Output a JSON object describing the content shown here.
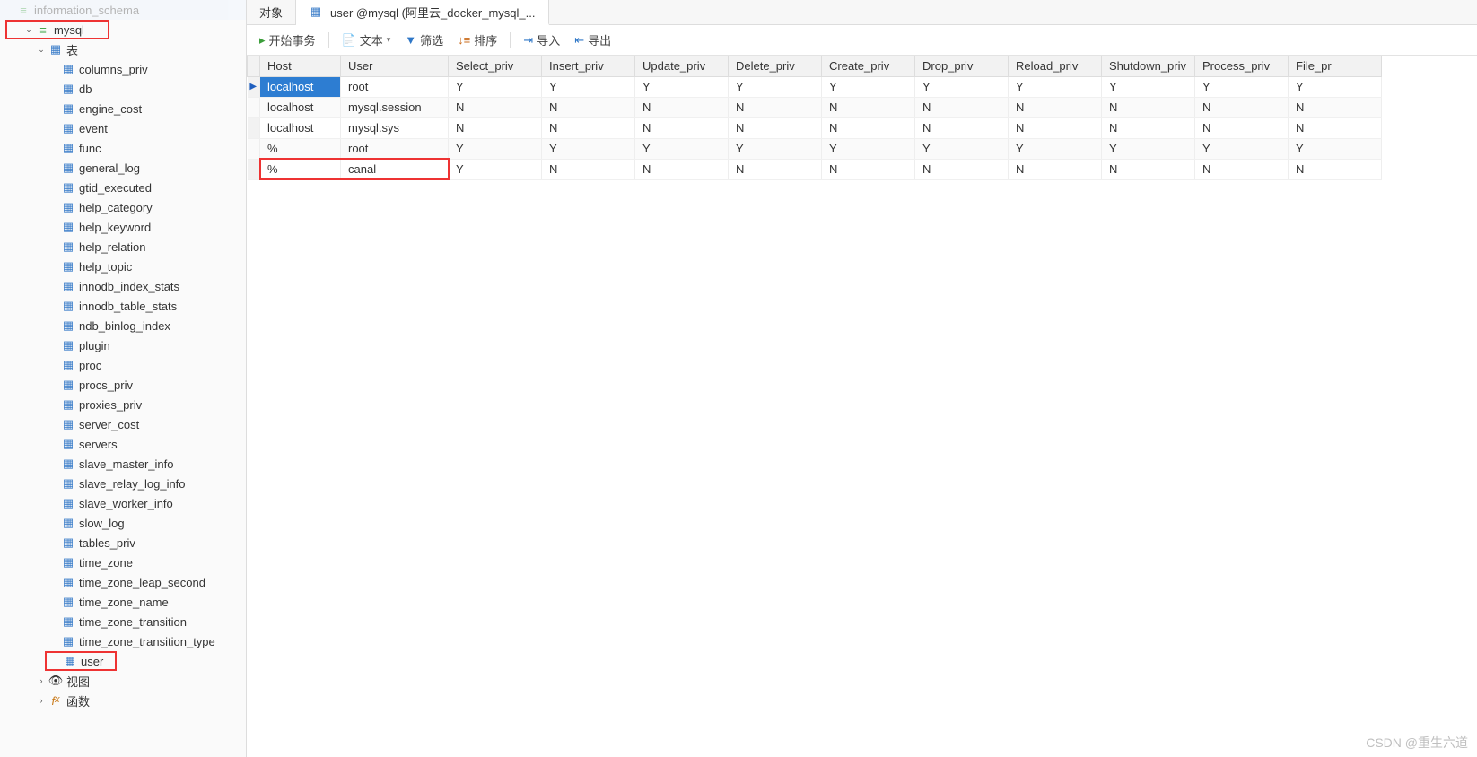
{
  "sidebar": {
    "top_cut": "information_schema",
    "db_mysql": "mysql",
    "tables_group": "表",
    "tables": [
      "columns_priv",
      "db",
      "engine_cost",
      "event",
      "func",
      "general_log",
      "gtid_executed",
      "help_category",
      "help_keyword",
      "help_relation",
      "help_topic",
      "innodb_index_stats",
      "innodb_table_stats",
      "ndb_binlog_index",
      "plugin",
      "proc",
      "procs_priv",
      "proxies_priv",
      "server_cost",
      "servers",
      "slave_master_info",
      "slave_relay_log_info",
      "slave_worker_info",
      "slow_log",
      "tables_priv",
      "time_zone",
      "time_zone_leap_second",
      "time_zone_name",
      "time_zone_transition",
      "time_zone_transition_type",
      "user"
    ],
    "views": "视图",
    "functions": "函数"
  },
  "tabs": {
    "objects": "对象",
    "user_tab": "user @mysql (阿里云_docker_mysql_..."
  },
  "toolbar": {
    "begin_tx": "开始事务",
    "text": "文本",
    "filter": "筛选",
    "sort": "排序",
    "import": "导入",
    "export": "导出"
  },
  "grid": {
    "columns": [
      "Host",
      "User",
      "Select_priv",
      "Insert_priv",
      "Update_priv",
      "Delete_priv",
      "Create_priv",
      "Drop_priv",
      "Reload_priv",
      "Shutdown_priv",
      "Process_priv",
      "File_pr"
    ],
    "rows": [
      {
        "Host": "localhost",
        "User": "root",
        "p": [
          "Y",
          "Y",
          "Y",
          "Y",
          "Y",
          "Y",
          "Y",
          "Y",
          "Y",
          "Y"
        ]
      },
      {
        "Host": "localhost",
        "User": "mysql.session",
        "p": [
          "N",
          "N",
          "N",
          "N",
          "N",
          "N",
          "N",
          "N",
          "N",
          "N"
        ]
      },
      {
        "Host": "localhost",
        "User": "mysql.sys",
        "p": [
          "N",
          "N",
          "N",
          "N",
          "N",
          "N",
          "N",
          "N",
          "N",
          "N"
        ]
      },
      {
        "Host": "%",
        "User": "root",
        "p": [
          "Y",
          "Y",
          "Y",
          "Y",
          "Y",
          "Y",
          "Y",
          "Y",
          "Y",
          "Y"
        ]
      },
      {
        "Host": "%",
        "User": "canal",
        "p": [
          "Y",
          "N",
          "N",
          "N",
          "N",
          "N",
          "N",
          "N",
          "N",
          "N"
        ]
      }
    ]
  },
  "watermark": "CSDN @重生六道"
}
